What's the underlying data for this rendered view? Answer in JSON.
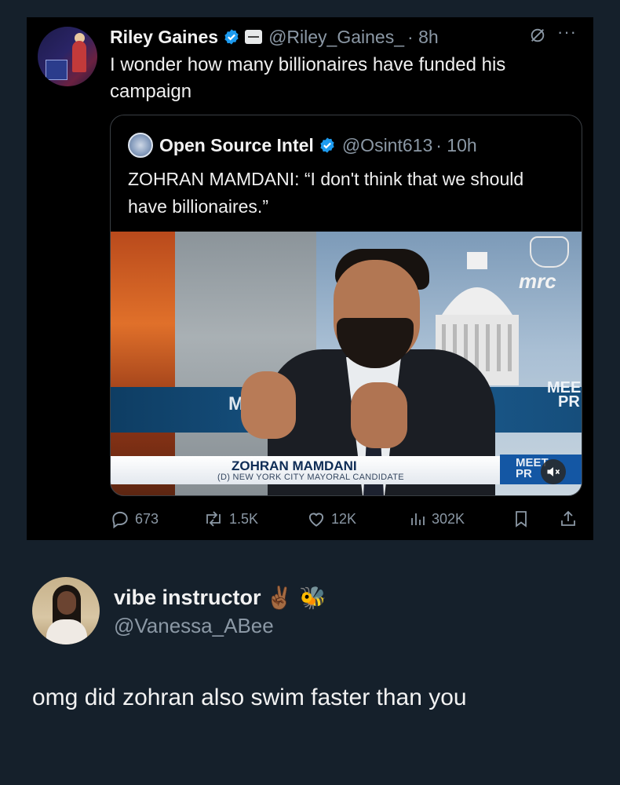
{
  "colors": {
    "background": "#15202b",
    "card": "#000000",
    "accent": "#1d9bf0",
    "muted": "#8b98a5",
    "text": "#e7e9ea"
  },
  "tweet": {
    "author_name": "Riley Gaines",
    "author_handle": "@Riley_Gaines_",
    "time": "· 8h",
    "text": "I wonder how many billionaires have funded his campaign",
    "avatar_icon": "profile-photo",
    "quoted": {
      "author_name": "Open Source Intel",
      "author_handle": "@Osint613",
      "time": "· 10h",
      "text": "ZOHRAN MAMDANI: “I don't think that we should have billionaires.”",
      "media": {
        "lower_third_name": "ZOHRAN MAMDANI",
        "lower_third_subtitle": "(D) NEW YORK CITY MAYORAL CANDIDATE",
        "watermark": "mrc",
        "band_text_left": "ME",
        "band_text_right_1": "MEE",
        "band_text_right_2": "PR",
        "corner_text_1": "MEET",
        "corner_text_2": "PR"
      }
    },
    "actions": {
      "replies": "673",
      "reposts": "1.5K",
      "likes": "12K",
      "views": "302K"
    }
  },
  "reply": {
    "author_name": "vibe instructor",
    "emoji": "✌🏾 🐝",
    "author_handle": "@Vanessa_ABee",
    "text": "omg did zohran also swim faster than you"
  }
}
